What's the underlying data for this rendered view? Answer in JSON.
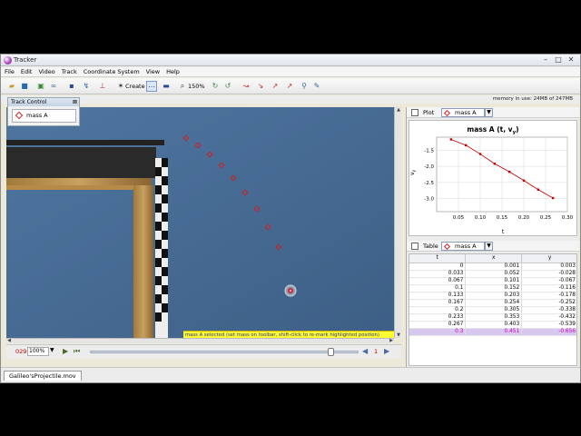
{
  "window": {
    "title": "Tracker",
    "minimize": "–",
    "maximize": "□",
    "close": "✕"
  },
  "menu": [
    "File",
    "Edit",
    "Video",
    "Track",
    "Coordinate System",
    "View",
    "Help"
  ],
  "toolbar": {
    "create_label": "Create",
    "zoom_label": "150%"
  },
  "status": {
    "memory": "memory in use: 24MB of 247MB"
  },
  "track_control": {
    "title": "Track Control",
    "close": "⊠",
    "track_button": "mass A"
  },
  "video": {
    "message": "mass A selected (set mass on toolbar, shift-click to re-mark highlighted position)",
    "colors": {
      "background": "#4a6e96",
      "mark": "#d02020",
      "message_bg": "#ffff32"
    }
  },
  "player": {
    "frame": "029",
    "zoom": "100%",
    "zoom_arrow": "▼",
    "rate": "1",
    "slider_position": 0.9
  },
  "file_tab": {
    "label": "Galileo'sProjectile.mov"
  },
  "plot_panel": {
    "header_label": "Plot",
    "track_select": "mass A",
    "drop": "▼",
    "chart_data": {
      "type": "scatter",
      "title": "mass A (t, v",
      "title_sub": "y",
      "title_end": ")",
      "xlabel": "t",
      "ylabel": "v",
      "ylabel_sub": "y",
      "xlim": [
        0.0,
        0.3
      ],
      "ylim": [
        -3.4,
        -1.1
      ],
      "xticks": [
        "0.05",
        "0.10",
        "0.15",
        "0.20",
        "0.25",
        "0.30"
      ],
      "yticks": [
        "-1.5",
        "-2.0",
        "-2.5",
        "-3.0"
      ],
      "xtick_values": [
        0.05,
        0.1,
        0.15,
        0.2,
        0.25,
        0.3
      ],
      "ytick_values": [
        -1.5,
        -2.0,
        -2.5,
        -3.0
      ],
      "grid": true,
      "series": [
        {
          "x": [
            0.033,
            0.067,
            0.1,
            0.133,
            0.167,
            0.2,
            0.233,
            0.267
          ],
          "y": [
            -1.17,
            -1.35,
            -1.62,
            -1.92,
            -2.17,
            -2.44,
            -2.72,
            -2.98
          ]
        }
      ],
      "color": "#c00000"
    }
  },
  "table_panel": {
    "header_label": "Table",
    "track_select": "mass A",
    "drop": "▼",
    "columns": [
      "t",
      "x",
      "y"
    ],
    "rows": [
      [
        "0",
        "0.001",
        "0.003"
      ],
      [
        "0.033",
        "0.052",
        "-0.028"
      ],
      [
        "0.067",
        "0.101",
        "-0.067"
      ],
      [
        "0.1",
        "0.152",
        "-0.116"
      ],
      [
        "0.133",
        "0.203",
        "-0.178"
      ],
      [
        "0.167",
        "0.254",
        "-0.252"
      ],
      [
        "0.2",
        "0.305",
        "-0.338"
      ],
      [
        "0.233",
        "0.353",
        "-0.432"
      ],
      [
        "0.267",
        "0.403",
        "-0.539"
      ],
      [
        "0.3",
        "0.451",
        "-0.656"
      ]
    ],
    "highlight_row": 9
  }
}
